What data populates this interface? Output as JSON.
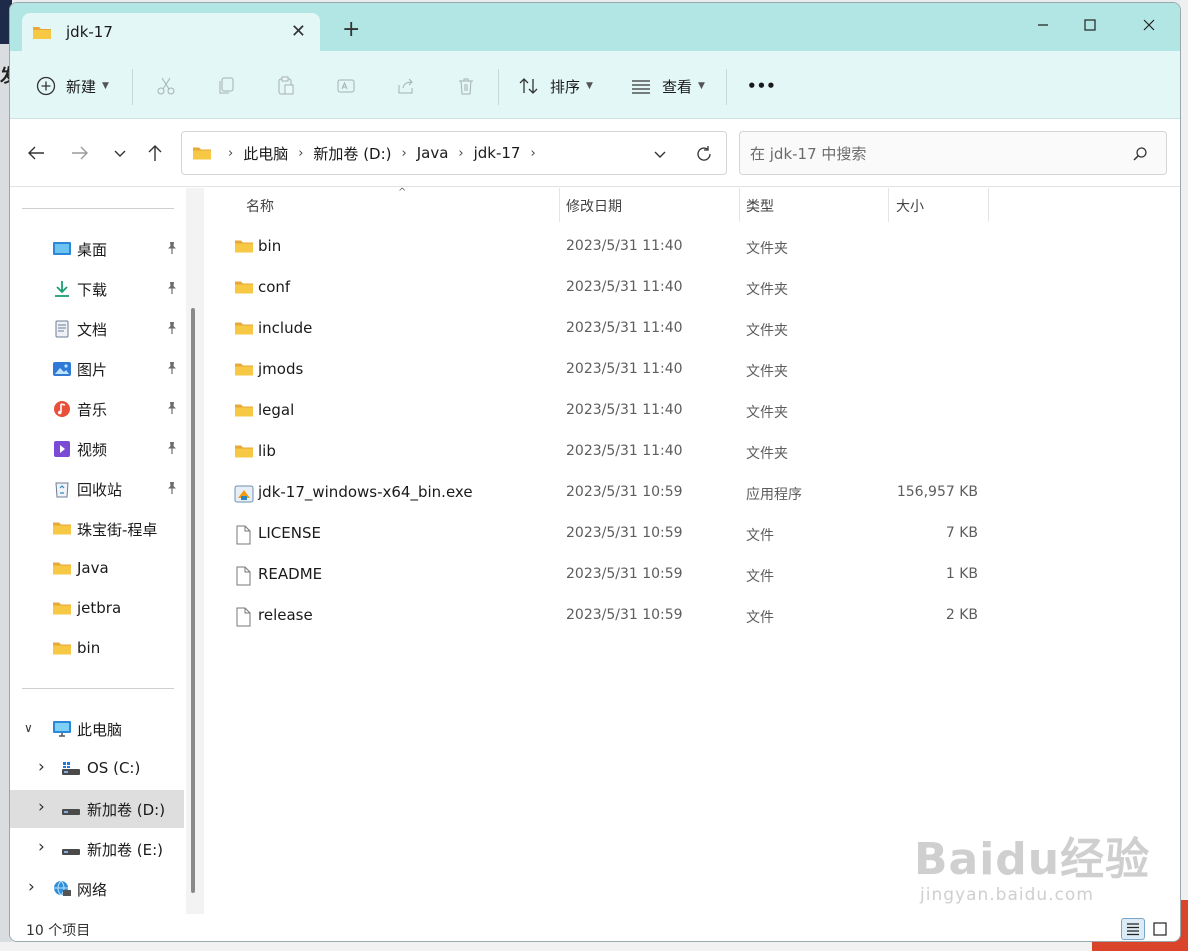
{
  "tab": {
    "title": "jdk-17"
  },
  "toolbar": {
    "new_label": "新建",
    "sort_label": "排序",
    "view_label": "查看",
    "more_label": "•••"
  },
  "address": {
    "crumbs": [
      "此电脑",
      "新加卷 (D:)",
      "Java",
      "jdk-17"
    ],
    "search_placeholder": "在 jdk-17 中搜索"
  },
  "sidebar": {
    "quick_access": [
      {
        "label": "桌面",
        "icon": "desktop-icon",
        "pinned": true
      },
      {
        "label": "下载",
        "icon": "download-icon",
        "pinned": true
      },
      {
        "label": "文档",
        "icon": "document-icon",
        "pinned": true
      },
      {
        "label": "图片",
        "icon": "pictures-icon",
        "pinned": true
      },
      {
        "label": "音乐",
        "icon": "music-icon",
        "pinned": true
      },
      {
        "label": "视频",
        "icon": "video-icon",
        "pinned": true
      },
      {
        "label": "回收站",
        "icon": "recycle-bin-icon",
        "pinned": true
      },
      {
        "label": "珠宝街-程卓",
        "icon": "folder-icon",
        "pinned": false
      },
      {
        "label": "Java",
        "icon": "folder-icon",
        "pinned": false
      },
      {
        "label": "jetbra",
        "icon": "folder-icon",
        "pinned": false
      },
      {
        "label": "bin",
        "icon": "folder-icon",
        "pinned": false
      }
    ],
    "this_pc": "此电脑",
    "drives": [
      "OS (C:)",
      "新加卷 (D:)",
      "新加卷 (E:)"
    ],
    "network": "网络"
  },
  "columns": {
    "name": "名称",
    "date": "修改日期",
    "type": "类型",
    "size": "大小"
  },
  "files": [
    {
      "name": "bin",
      "date": "2023/5/31 11:40",
      "type": "文件夹",
      "size": "",
      "icon": "folder-icon"
    },
    {
      "name": "conf",
      "date": "2023/5/31 11:40",
      "type": "文件夹",
      "size": "",
      "icon": "folder-icon"
    },
    {
      "name": "include",
      "date": "2023/5/31 11:40",
      "type": "文件夹",
      "size": "",
      "icon": "folder-icon"
    },
    {
      "name": "jmods",
      "date": "2023/5/31 11:40",
      "type": "文件夹",
      "size": "",
      "icon": "folder-icon"
    },
    {
      "name": "legal",
      "date": "2023/5/31 11:40",
      "type": "文件夹",
      "size": "",
      "icon": "folder-icon"
    },
    {
      "name": "lib",
      "date": "2023/5/31 11:40",
      "type": "文件夹",
      "size": "",
      "icon": "folder-icon"
    },
    {
      "name": "jdk-17_windows-x64_bin.exe",
      "date": "2023/5/31 10:59",
      "type": "应用程序",
      "size": "156,957 KB",
      "icon": "installer-icon"
    },
    {
      "name": "LICENSE",
      "date": "2023/5/31 10:59",
      "type": "文件",
      "size": "7 KB",
      "icon": "file-icon"
    },
    {
      "name": "README",
      "date": "2023/5/31 10:59",
      "type": "文件",
      "size": "1 KB",
      "icon": "file-icon"
    },
    {
      "name": "release",
      "date": "2023/5/31 10:59",
      "type": "文件",
      "size": "2 KB",
      "icon": "file-icon"
    }
  ],
  "status": {
    "item_count": "10 个项目"
  },
  "watermark": {
    "line1": "Baidu经验",
    "line2": "jingyan.baidu.com"
  },
  "colors": {
    "titlebar": "#b1e6e4",
    "toolbar": "#e3f7f6",
    "folder": "#f7c843",
    "selection": "#dedede"
  }
}
